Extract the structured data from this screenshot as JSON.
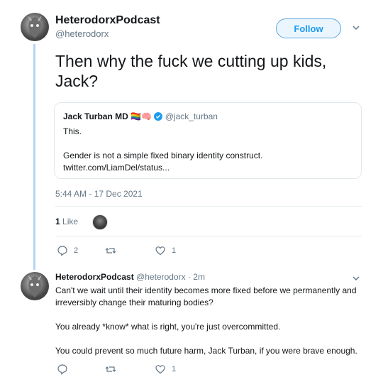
{
  "tweet": {
    "author_name": "HeterodorxPodcast",
    "author_handle": "@heterodorx",
    "follow_label": "Follow",
    "text": "Then why the fuck we cutting up kids, Jack?",
    "time": "5:44 AM - 17 Dec 2021",
    "likes_count": "1",
    "likes_label": "Like",
    "reply_count": "2",
    "retweet_count": "",
    "like_count": "1"
  },
  "quote": {
    "author_name": "Jack Turban MD",
    "emojis": "🏳️‍🌈🧠",
    "author_handle": "@jack_turban",
    "lines": [
      "This.",
      "",
      "Gender is not a simple fixed binary identity construct.",
      "twitter.com/LiamDel/status..."
    ]
  },
  "reply": {
    "author_name": "HeterodorxPodcast",
    "author_handle": "@heterodorx",
    "time": "2m",
    "paragraphs": [
      "Can't we wait until their identity becomes more fixed before we permanently and irreversibly change their maturing bodies?",
      "You already *know* what is right, you're just overcommitted.",
      "You could prevent so much future harm, Jack Turban, if you were brave enough."
    ],
    "like_count": "1"
  },
  "colors": {
    "accent": "#1d9bf0",
    "thread_line": "#b6d3f4",
    "muted": "#657786",
    "like_heart": "#657786"
  }
}
